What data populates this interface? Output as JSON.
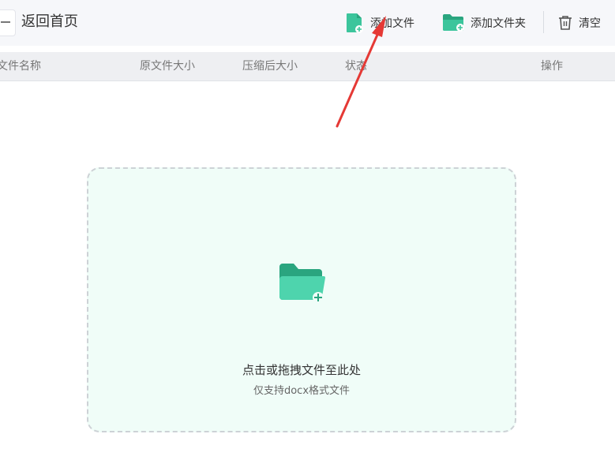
{
  "toolbar": {
    "back_label": "返回首页",
    "add_file_label": "添加文件",
    "add_folder_label": "添加文件夹",
    "clear_label": "清空"
  },
  "table": {
    "columns": [
      "文件名称",
      "原文件大小",
      "压缩后大小",
      "状态",
      "操作"
    ]
  },
  "drop_zone": {
    "main_text": "点击或拖拽文件至此处",
    "sub_text": "仅支持docx格式文件"
  },
  "colors": {
    "accent_green": "#3cc59c",
    "annotation_red": "#e53935"
  },
  "icons": {
    "back": "arrow-left-icon",
    "add_file": "file-add-icon",
    "add_folder": "folder-add-icon",
    "clear": "trash-icon",
    "drop": "folder-plus-icon"
  }
}
